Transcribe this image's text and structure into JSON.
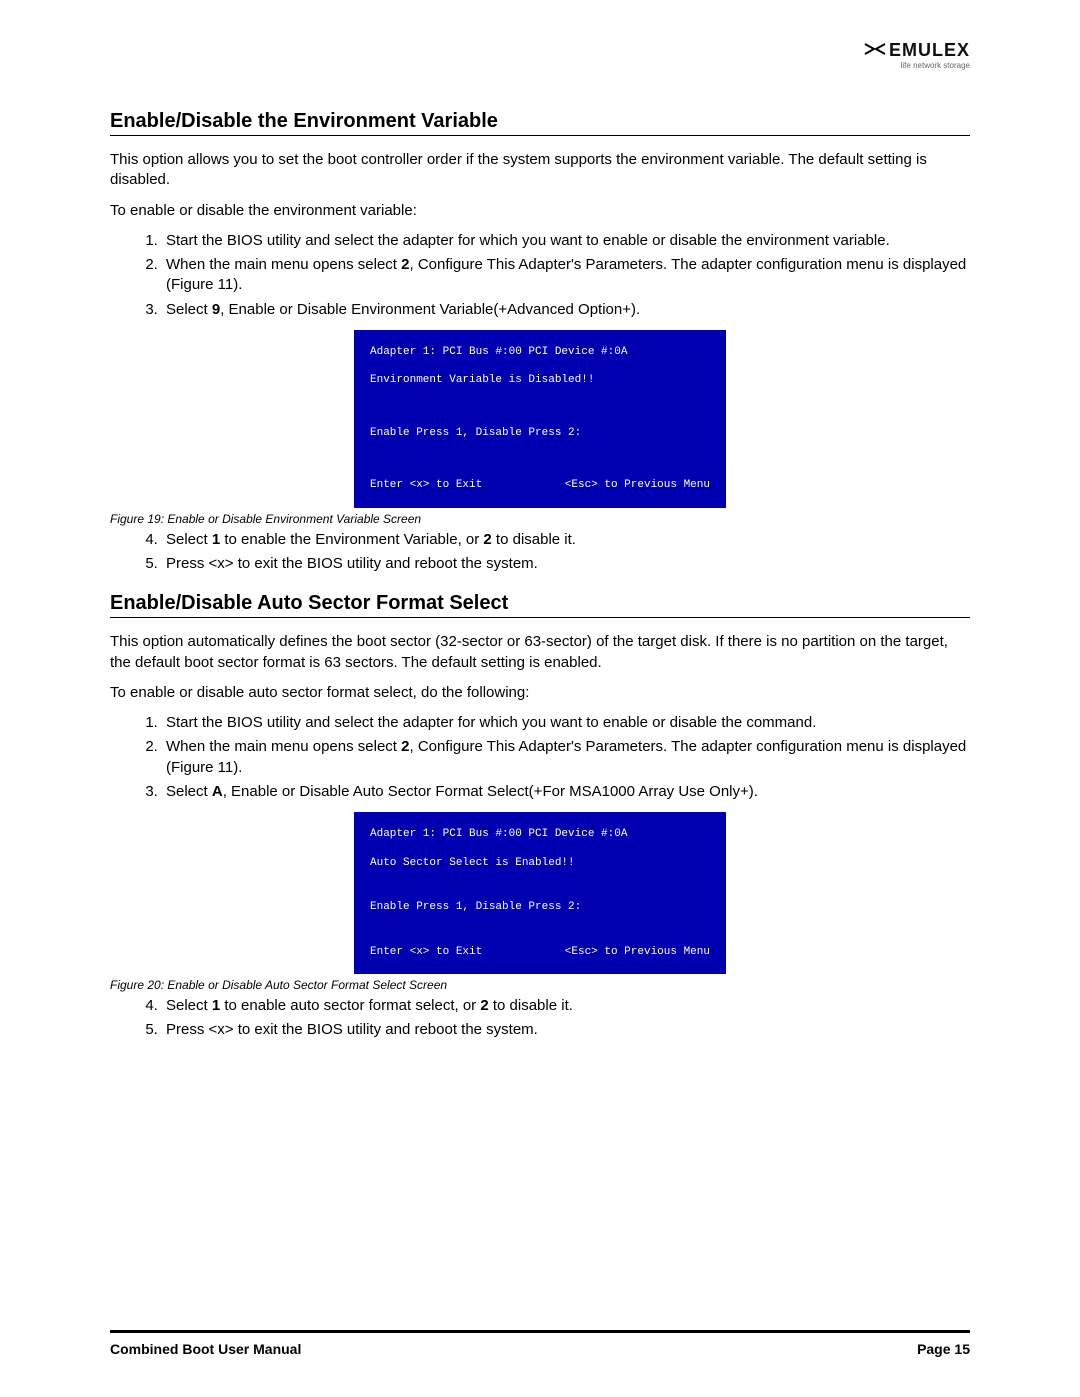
{
  "logo": {
    "brand": "EMULEX",
    "tagline": "life network storage"
  },
  "section1": {
    "title": "Enable/Disable the Environment Variable",
    "intro": "This option allows you to set the boot controller order if the system supports the environment variable. The default setting is disabled.",
    "lead": "To enable or disable the environment variable:",
    "step1": "Start the BIOS utility and select the adapter for which you want to enable or disable the environment variable.",
    "step2_a": "When the main menu opens select ",
    "step2_b": "2",
    "step2_c": ", Configure This Adapter's Parameters. The adapter configuration menu is displayed (Figure 11).",
    "step3_a": "Select ",
    "step3_b": "9",
    "step3_c": ", Enable or Disable Environment Variable(+Advanced Option+).",
    "step4_a": "Select ",
    "step4_b": "1",
    "step4_c": " to enable the Environment Variable, or ",
    "step4_d": "2",
    "step4_e": " to disable it.",
    "step5": "Press <x> to exit the BIOS utility and reboot the system.",
    "caption": "Figure 19: Enable or Disable Environment Variable Screen"
  },
  "bios1": {
    "line1": "Adapter 1: PCI Bus #:00 PCI Device #:0A",
    "line2": "Environment Variable is Disabled!!",
    "line3": "Enable Press 1, Disable Press 2:",
    "footL": "Enter <x> to Exit",
    "footR": "<Esc> to Previous Menu"
  },
  "section2": {
    "title": "Enable/Disable Auto Sector Format Select",
    "intro": "This option automatically defines the boot sector (32-sector or 63-sector) of the target disk. If there is no partition on the target, the default boot sector format is 63 sectors. The default setting is enabled.",
    "lead": "To enable or disable auto sector format select, do the following:",
    "step1": "Start the BIOS utility and select the adapter for which you want to enable or disable the command.",
    "step2_a": "When the main menu opens select ",
    "step2_b": "2",
    "step2_c": ", Configure This Adapter's Parameters. The adapter configuration menu is displayed (Figure 11).",
    "step3_a": "Select ",
    "step3_b": "A",
    "step3_c": ", Enable or Disable Auto Sector Format Select(+For MSA1000 Array Use Only+).",
    "step4_a": "Select ",
    "step4_b": "1",
    "step4_c": " to enable auto sector format select, or ",
    "step4_d": "2",
    "step4_e": " to disable it.",
    "step5": "Press <x> to exit the BIOS utility and reboot the system.",
    "caption": "Figure 20: Enable or Disable Auto Sector Format Select Screen"
  },
  "bios2": {
    "line1": "Adapter 1: PCI Bus #:00 PCI Device #:0A",
    "line2": "Auto Sector Select is Enabled!!",
    "line3": "Enable Press 1, Disable Press 2:",
    "footL": "Enter <x> to Exit",
    "footR": "<Esc> to Previous Menu"
  },
  "footer": {
    "left": "Combined Boot User Manual",
    "right": "Page 15"
  }
}
